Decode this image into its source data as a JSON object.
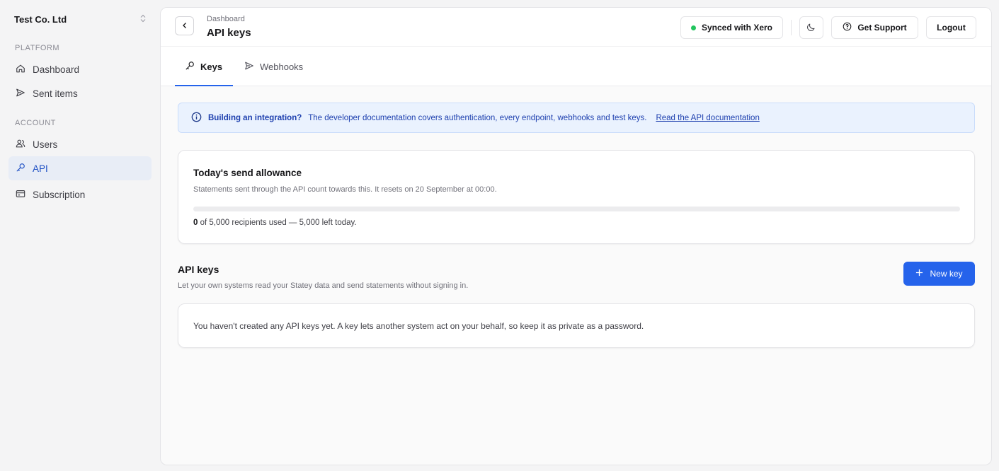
{
  "sidebar": {
    "org_name": "Test Co. Ltd",
    "sections": [
      {
        "label": "PLATFORM",
        "items": [
          {
            "label": "Dashboard",
            "icon": "home-icon",
            "active": false
          },
          {
            "label": "Sent items",
            "icon": "send-icon",
            "active": false
          }
        ]
      },
      {
        "label": "ACCOUNT",
        "items": [
          {
            "label": "Users",
            "icon": "users-icon",
            "active": false
          },
          {
            "label": "API",
            "icon": "key-icon",
            "active": true
          },
          {
            "label": "Subscription",
            "icon": "credit-card-icon",
            "active": false
          }
        ]
      }
    ]
  },
  "header": {
    "breadcrumb": "Dashboard",
    "title": "API keys",
    "sync_status": "Synced with Xero",
    "support_label": "Get Support",
    "logout_label": "Logout"
  },
  "tabs": [
    {
      "label": "Keys",
      "icon": "key-icon",
      "active": true
    },
    {
      "label": "Webhooks",
      "icon": "send-icon",
      "active": false
    }
  ],
  "info_banner": {
    "bold": "Building an integration?",
    "text": "The developer documentation covers authentication, every endpoint, webhooks and test keys.",
    "link": "Read the API documentation"
  },
  "allowance": {
    "title": "Today's send allowance",
    "description": "Statements sent through the API count towards this. It resets on 20 September at 00:00.",
    "used": "0",
    "usage_text": "of 5,000 recipients used — 5,000 left today.",
    "progress_fraction": 0
  },
  "api_keys": {
    "title": "API keys",
    "description": "Let your own systems read your Statey data and send statements without signing in.",
    "new_key_label": "New key",
    "empty_text": "You haven't created any API keys yet. A key lets another system act on your behalf, so keep it as private as a password."
  },
  "colors": {
    "accent": "#2563eb",
    "sync_dot": "#22c55e",
    "info_bg": "#eaf2fe",
    "active_nav_bg": "#e8edf6"
  }
}
